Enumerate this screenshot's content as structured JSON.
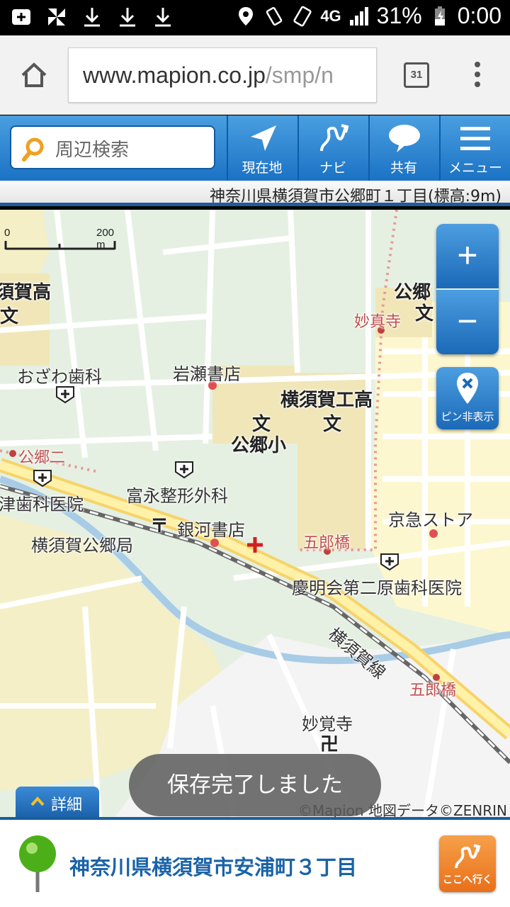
{
  "status_bar": {
    "battery": "31%",
    "time": "0:00",
    "network": "4G"
  },
  "browser": {
    "url_main": "www.mapion.co.jp",
    "url_dim": "/smp/n",
    "tabs_count": "31"
  },
  "app_header": {
    "search_placeholder": "周辺検索",
    "nav": [
      {
        "label": "現在地",
        "icon": "location-arrow-icon"
      },
      {
        "label": "ナビ",
        "icon": "route-icon"
      },
      {
        "label": "共有",
        "icon": "speech-bubble-icon"
      },
      {
        "label": "メニュー",
        "icon": "hamburger-menu-icon"
      }
    ]
  },
  "address_bar": "神奈川県横須賀市公郷町１丁目(標高:9m)",
  "map": {
    "scale": {
      "start": "0",
      "end": "200 m"
    },
    "labels": [
      "須賀高",
      "文",
      "公郷",
      "文",
      "妙真寺",
      "おざわ歯科",
      "岩瀬書店",
      "横須賀工高",
      "文",
      "文",
      "公郷小",
      "公郷二",
      "富永整形外科",
      "津歯科医院",
      "〒",
      "銀河書店",
      "横須賀公郷局",
      "五郎橋",
      "京急ストア",
      "慶明会第二原歯科医院",
      "横須賀線",
      "五郎橋",
      "妙覚寺",
      "卍"
    ],
    "zoom_in": "+",
    "zoom_out": "−",
    "pin_toggle": "ピン非表示",
    "toast": "保存完了しました",
    "copyright": "©Mapion 地図データ©ZENRIN",
    "detail_tab": "詳細"
  },
  "bottom": {
    "address": "神奈川県横須賀市安浦町３丁目",
    "go_button": "ここへ行く"
  },
  "colors": {
    "header_blue": "#1b72c4",
    "bottom_text": "#1a63a8",
    "go_orange": "#e9701a",
    "map_green": "#e5f0e2",
    "map_yellow": "#fdf7cf"
  }
}
